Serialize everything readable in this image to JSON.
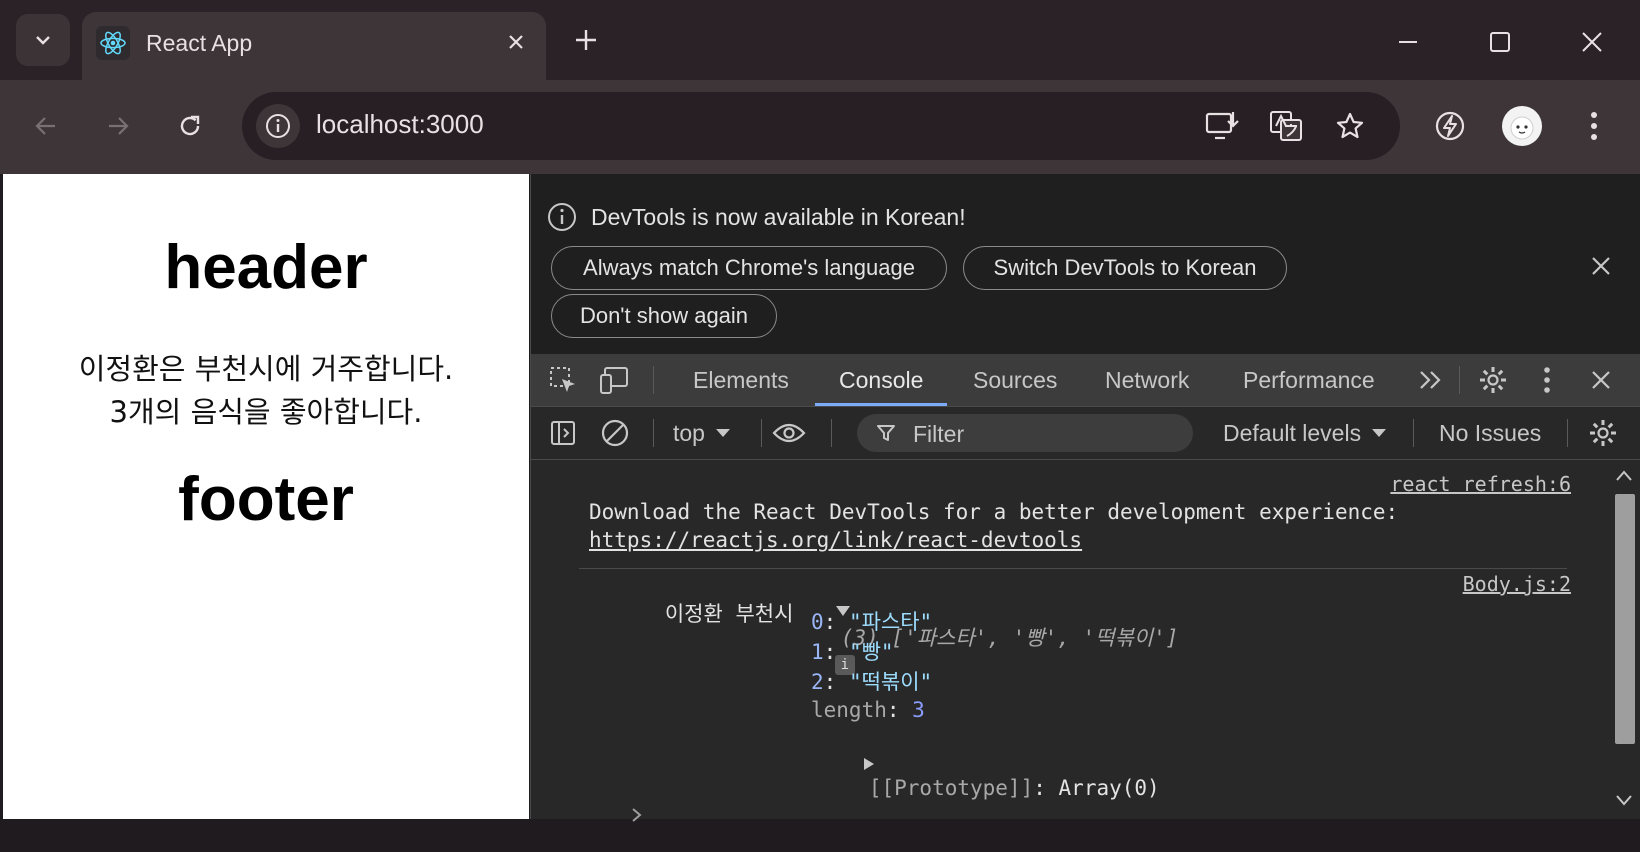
{
  "browser": {
    "tab_title": "React App",
    "url": "localhost:3000"
  },
  "page": {
    "header": "header",
    "body_line1": "이정환은 부천시에 거주합니다.",
    "body_line2": "3개의 음식을 좋아합니다.",
    "footer": "footer"
  },
  "devtools": {
    "infobar": {
      "message": "DevTools is now available in Korean!",
      "btn_match": "Always match Chrome's language",
      "btn_switch": "Switch DevTools to Korean",
      "btn_dont_show": "Don't show again"
    },
    "tabs": [
      "Elements",
      "Console",
      "Sources",
      "Network",
      "Performance"
    ],
    "active_tab": "Console",
    "console_bar": {
      "context": "top",
      "filter_placeholder": "Filter",
      "levels": "Default levels",
      "issues": "No Issues"
    },
    "console": {
      "msg1_source": "react refresh:6",
      "msg1_text": "Download the React DevTools for a better development experience:",
      "msg1_link": "https://reactjs.org/link/react-devtools",
      "msg2_source": "Body.js:2",
      "msg2_prefix": "이정환 부천시",
      "msg2_summary": "(3) ['파스타', '빵', '떡볶이']",
      "items": [
        {
          "key": "0",
          "value": "\"파스타\""
        },
        {
          "key": "1",
          "value": "\"빵\""
        },
        {
          "key": "2",
          "value": "\"떡볶이\""
        }
      ],
      "length_key": "length",
      "length_value": "3",
      "prototype": "[[Prototype]]",
      "prototype_value": "Array(0)"
    }
  },
  "colors": {
    "accent": "#7cacf8",
    "devtools_bg": "#282828",
    "chrome_frame": "#2a2226"
  }
}
